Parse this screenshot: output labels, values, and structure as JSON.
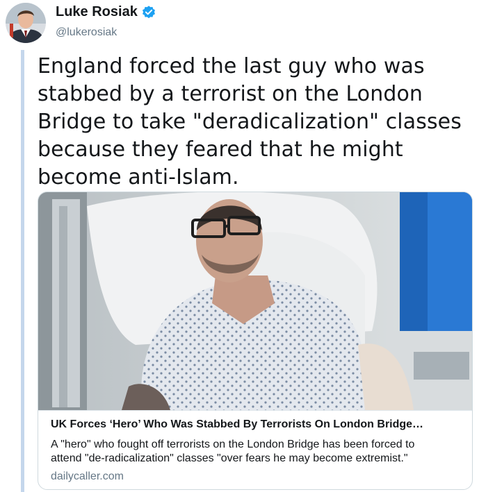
{
  "author": {
    "display_name": "Luke Rosiak",
    "handle": "@lukerosiak",
    "verified": true,
    "avatar_icon": "profile-photo"
  },
  "tweet": {
    "text_lines": [
      "England forced the last guy who was",
      "stabbed by a terrorist on the London",
      "Bridge to take \"deradicalization\" classes",
      "because they feared that he might",
      "become anti-Islam."
    ]
  },
  "card": {
    "image_icon": "hospital-patient-photo",
    "title": "UK Forces ‘Hero’ Who Was Stabbed By Terrorists On London Bridge…",
    "description_lines": [
      "A \"hero\" who fought off terrorists on the London Bridge has been forced to",
      "attend \"de-radicalization\" classes \"over fears he may become extremist.\""
    ],
    "domain": "dailycaller.com"
  },
  "colors": {
    "verified_blue": "#1da1f2",
    "thread_line": "#c4d6ec",
    "muted_text": "#657786"
  }
}
